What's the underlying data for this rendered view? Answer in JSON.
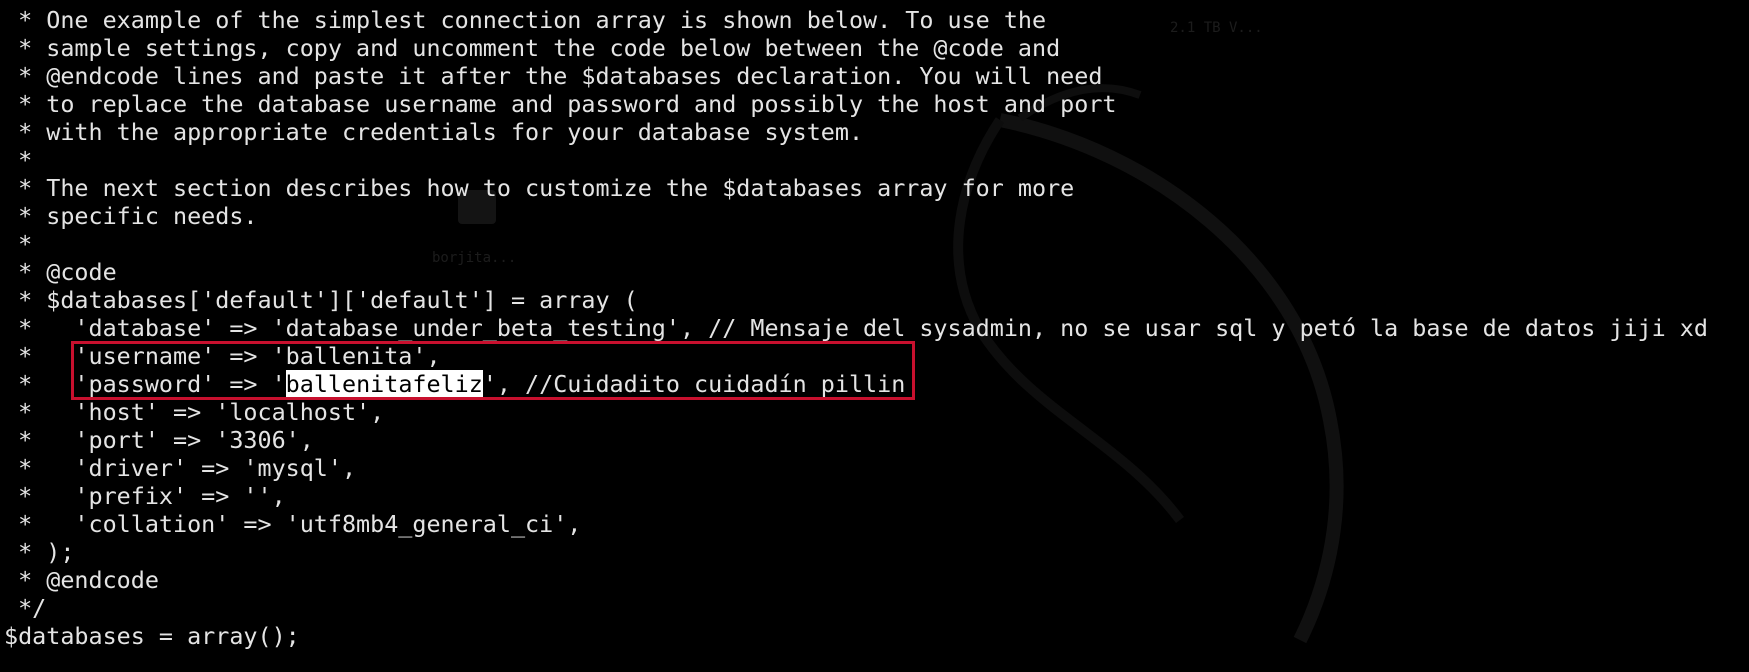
{
  "theme": {
    "background": "#000000",
    "foreground": "#e4e4e4",
    "annotation_color": "#c8102e",
    "selection_background": "#ffffff",
    "selection_foreground": "#000000"
  },
  "wallpaper": {
    "icon_label_1": "borjita...",
    "icon_label_2": "2.1 TB V..."
  },
  "code": {
    "line_01": " * One example of the simplest connection array is shown below. To use the",
    "line_02": " * sample settings, copy and uncomment the code below between the @code and",
    "line_03": " * @endcode lines and paste it after the $databases declaration. You will need",
    "line_04": " * to replace the database username and password and possibly the host and port",
    "line_05": " * with the appropriate credentials for your database system.",
    "line_06": " *",
    "line_07": " * The next section describes how to customize the $databases array for more",
    "line_08": " * specific needs.",
    "line_09": " *",
    "line_10": " * @code",
    "line_11": " * $databases['default']['default'] = array (",
    "line_12": " *   'database' => 'database_under_beta_testing', // Mensaje del sysadmin, no se usar sql y petó la base de datos jiji xd",
    "line_13": " *   'username' => 'ballenita',",
    "line_14_prefix": " *   'password' => '",
    "line_14_selected": "ballenitafeliz",
    "line_14_suffix": "', //Cuidadito cuidadín pillin",
    "line_15": " *   'host' => 'localhost',",
    "line_16": " *   'port' => '3306',",
    "line_17": " *   'driver' => 'mysql',",
    "line_18": " *   'prefix' => '',",
    "line_19": " *   'collation' => 'utf8mb4_general_ci',",
    "line_20": " * );",
    "line_21": " * @endcode",
    "line_22": " */",
    "line_23": "$databases = array();"
  }
}
